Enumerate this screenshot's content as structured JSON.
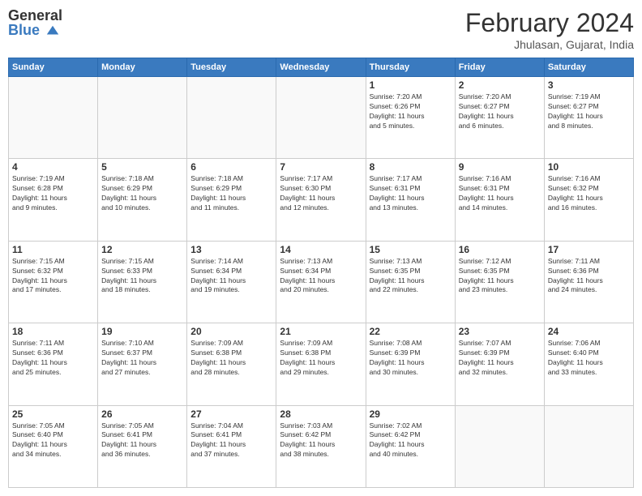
{
  "header": {
    "logo_general": "General",
    "logo_blue": "Blue",
    "title": "February 2024",
    "subtitle": "Jhulasan, Gujarat, India"
  },
  "calendar": {
    "days_of_week": [
      "Sunday",
      "Monday",
      "Tuesday",
      "Wednesday",
      "Thursday",
      "Friday",
      "Saturday"
    ],
    "weeks": [
      [
        {
          "day": "",
          "info": ""
        },
        {
          "day": "",
          "info": ""
        },
        {
          "day": "",
          "info": ""
        },
        {
          "day": "",
          "info": ""
        },
        {
          "day": "1",
          "info": "Sunrise: 7:20 AM\nSunset: 6:26 PM\nDaylight: 11 hours\nand 5 minutes."
        },
        {
          "day": "2",
          "info": "Sunrise: 7:20 AM\nSunset: 6:27 PM\nDaylight: 11 hours\nand 6 minutes."
        },
        {
          "day": "3",
          "info": "Sunrise: 7:19 AM\nSunset: 6:27 PM\nDaylight: 11 hours\nand 8 minutes."
        }
      ],
      [
        {
          "day": "4",
          "info": "Sunrise: 7:19 AM\nSunset: 6:28 PM\nDaylight: 11 hours\nand 9 minutes."
        },
        {
          "day": "5",
          "info": "Sunrise: 7:18 AM\nSunset: 6:29 PM\nDaylight: 11 hours\nand 10 minutes."
        },
        {
          "day": "6",
          "info": "Sunrise: 7:18 AM\nSunset: 6:29 PM\nDaylight: 11 hours\nand 11 minutes."
        },
        {
          "day": "7",
          "info": "Sunrise: 7:17 AM\nSunset: 6:30 PM\nDaylight: 11 hours\nand 12 minutes."
        },
        {
          "day": "8",
          "info": "Sunrise: 7:17 AM\nSunset: 6:31 PM\nDaylight: 11 hours\nand 13 minutes."
        },
        {
          "day": "9",
          "info": "Sunrise: 7:16 AM\nSunset: 6:31 PM\nDaylight: 11 hours\nand 14 minutes."
        },
        {
          "day": "10",
          "info": "Sunrise: 7:16 AM\nSunset: 6:32 PM\nDaylight: 11 hours\nand 16 minutes."
        }
      ],
      [
        {
          "day": "11",
          "info": "Sunrise: 7:15 AM\nSunset: 6:32 PM\nDaylight: 11 hours\nand 17 minutes."
        },
        {
          "day": "12",
          "info": "Sunrise: 7:15 AM\nSunset: 6:33 PM\nDaylight: 11 hours\nand 18 minutes."
        },
        {
          "day": "13",
          "info": "Sunrise: 7:14 AM\nSunset: 6:34 PM\nDaylight: 11 hours\nand 19 minutes."
        },
        {
          "day": "14",
          "info": "Sunrise: 7:13 AM\nSunset: 6:34 PM\nDaylight: 11 hours\nand 20 minutes."
        },
        {
          "day": "15",
          "info": "Sunrise: 7:13 AM\nSunset: 6:35 PM\nDaylight: 11 hours\nand 22 minutes."
        },
        {
          "day": "16",
          "info": "Sunrise: 7:12 AM\nSunset: 6:35 PM\nDaylight: 11 hours\nand 23 minutes."
        },
        {
          "day": "17",
          "info": "Sunrise: 7:11 AM\nSunset: 6:36 PM\nDaylight: 11 hours\nand 24 minutes."
        }
      ],
      [
        {
          "day": "18",
          "info": "Sunrise: 7:11 AM\nSunset: 6:36 PM\nDaylight: 11 hours\nand 25 minutes."
        },
        {
          "day": "19",
          "info": "Sunrise: 7:10 AM\nSunset: 6:37 PM\nDaylight: 11 hours\nand 27 minutes."
        },
        {
          "day": "20",
          "info": "Sunrise: 7:09 AM\nSunset: 6:38 PM\nDaylight: 11 hours\nand 28 minutes."
        },
        {
          "day": "21",
          "info": "Sunrise: 7:09 AM\nSunset: 6:38 PM\nDaylight: 11 hours\nand 29 minutes."
        },
        {
          "day": "22",
          "info": "Sunrise: 7:08 AM\nSunset: 6:39 PM\nDaylight: 11 hours\nand 30 minutes."
        },
        {
          "day": "23",
          "info": "Sunrise: 7:07 AM\nSunset: 6:39 PM\nDaylight: 11 hours\nand 32 minutes."
        },
        {
          "day": "24",
          "info": "Sunrise: 7:06 AM\nSunset: 6:40 PM\nDaylight: 11 hours\nand 33 minutes."
        }
      ],
      [
        {
          "day": "25",
          "info": "Sunrise: 7:05 AM\nSunset: 6:40 PM\nDaylight: 11 hours\nand 34 minutes."
        },
        {
          "day": "26",
          "info": "Sunrise: 7:05 AM\nSunset: 6:41 PM\nDaylight: 11 hours\nand 36 minutes."
        },
        {
          "day": "27",
          "info": "Sunrise: 7:04 AM\nSunset: 6:41 PM\nDaylight: 11 hours\nand 37 minutes."
        },
        {
          "day": "28",
          "info": "Sunrise: 7:03 AM\nSunset: 6:42 PM\nDaylight: 11 hours\nand 38 minutes."
        },
        {
          "day": "29",
          "info": "Sunrise: 7:02 AM\nSunset: 6:42 PM\nDaylight: 11 hours\nand 40 minutes."
        },
        {
          "day": "",
          "info": ""
        },
        {
          "day": "",
          "info": ""
        }
      ]
    ]
  }
}
